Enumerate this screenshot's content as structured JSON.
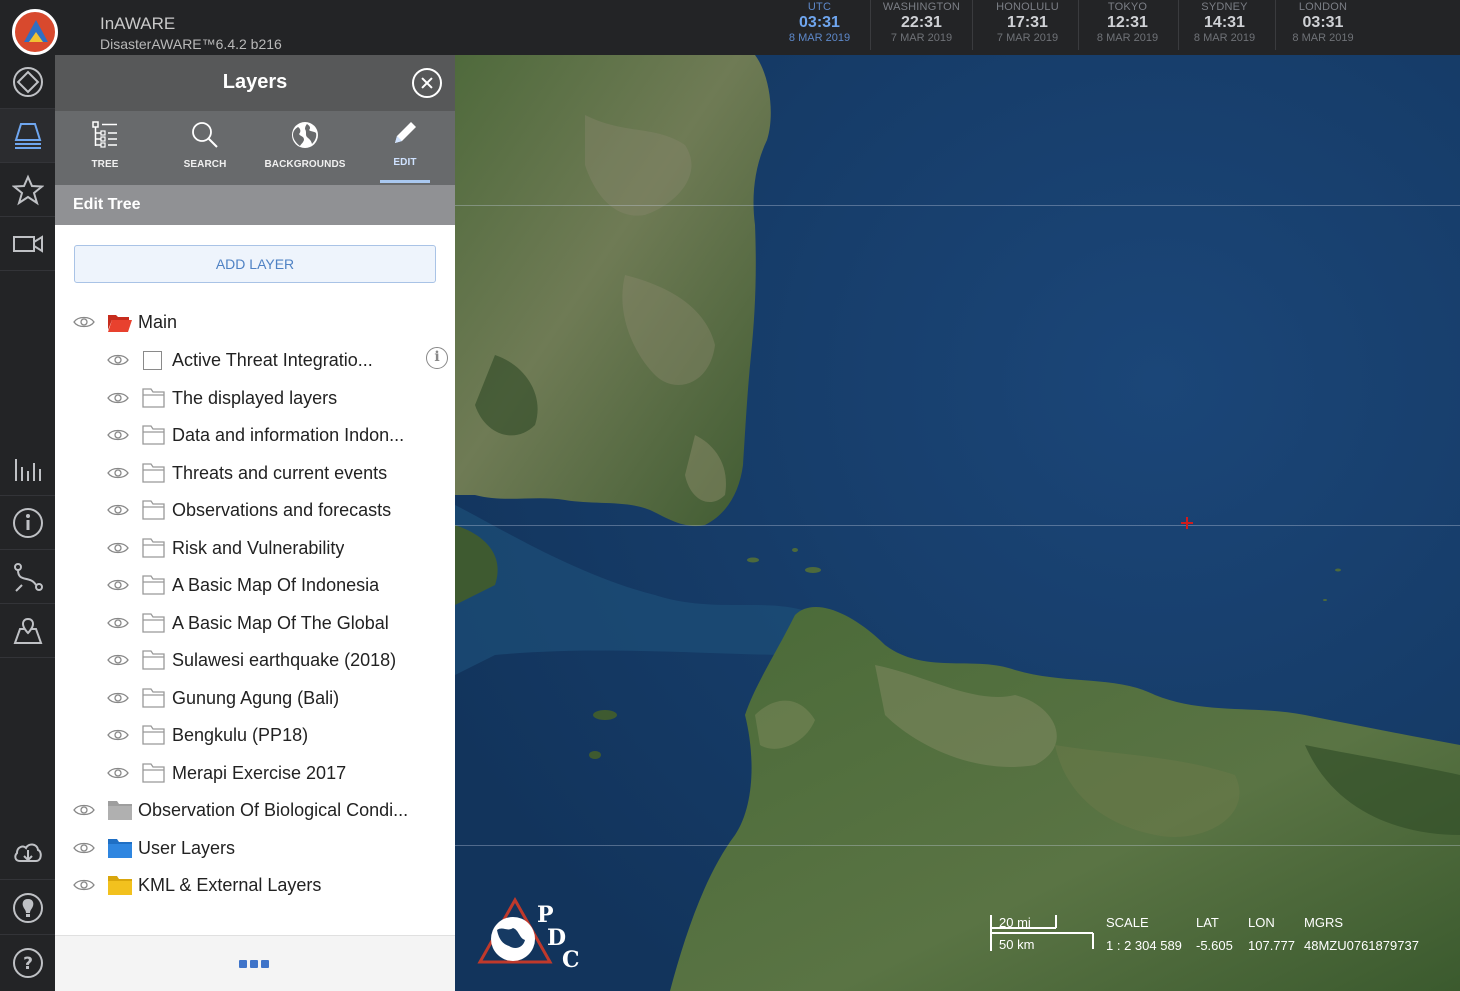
{
  "app": {
    "title": "InAWARE",
    "subtitle": "DisasterAWARE™6.4.2 b216"
  },
  "clocks": [
    {
      "city": "UTC",
      "time": "03:31",
      "date": "8 MAR 2019"
    },
    {
      "city": "WASHINGTON",
      "time": "22:31",
      "date": "7 MAR 2019"
    },
    {
      "city": "HONOLULU",
      "time": "17:31",
      "date": "7 MAR 2019"
    },
    {
      "city": "TOKYO",
      "time": "12:31",
      "date": "8 MAR 2019"
    },
    {
      "city": "SYDNEY",
      "time": "14:31",
      "date": "8 MAR 2019"
    },
    {
      "city": "LONDON",
      "time": "03:31",
      "date": "8 MAR 2019"
    }
  ],
  "rail": [
    "hazards-icon",
    "layers-icon",
    "favorites-icon",
    "video-icon",
    "analytics-icon",
    "info-icon",
    "routing-icon",
    "map-marker-icon",
    "download-icon",
    "tips-icon",
    "help-icon"
  ],
  "panel": {
    "title": "Layers",
    "tabs": [
      {
        "label": "TREE",
        "icon": "tree-icon"
      },
      {
        "label": "SEARCH",
        "icon": "search-icon"
      },
      {
        "label": "BACKGROUNDS",
        "icon": "globe-icon"
      },
      {
        "label": "EDIT",
        "icon": "pencil-icon"
      }
    ],
    "active_tab": "EDIT",
    "section_title": "Edit Tree",
    "add_layer_label": "ADD LAYER",
    "tree": {
      "root": {
        "label": "Main",
        "folder_color": "#e8412e"
      },
      "children": [
        {
          "label": "Active Threat Integratio...",
          "type": "checkbox"
        },
        {
          "label": "The displayed layers",
          "type": "folder"
        },
        {
          "label": "Data and information Indon...",
          "type": "folder"
        },
        {
          "label": "Threats and current events",
          "type": "folder"
        },
        {
          "label": "Observations and forecasts",
          "type": "folder"
        },
        {
          "label": "Risk and Vulnerability",
          "type": "folder"
        },
        {
          "label": "A Basic Map Of Indonesia",
          "type": "folder"
        },
        {
          "label": "A Basic Map Of The Global",
          "type": "folder"
        },
        {
          "label": "Sulawesi earthquake (2018)",
          "type": "folder"
        },
        {
          "label": "Gunung Agung (Bali)",
          "type": "folder"
        },
        {
          "label": "Bengkulu (PP18)",
          "type": "folder"
        },
        {
          "label": "Merapi Exercise 2017",
          "type": "folder"
        }
      ],
      "top_level": [
        {
          "label": "Observation Of Biological Condi...",
          "folder_color": "#9e9e9e"
        },
        {
          "label": "User Layers",
          "folder_color": "#2f86e0"
        },
        {
          "label": "KML & External Layers",
          "folder_color": "#f2c11e"
        }
      ]
    }
  },
  "map": {
    "logo_letters": [
      "P",
      "D",
      "C"
    ],
    "scale_mi": "20 mi",
    "scale_km": "50 km",
    "readout": [
      {
        "label": "SCALE",
        "value": "1 : 2 304 589"
      },
      {
        "label": "LAT",
        "value": "-5.605"
      },
      {
        "label": "LON",
        "value": "107.777"
      },
      {
        "label": "MGRS",
        "value": "48MZU0761879737"
      }
    ]
  }
}
